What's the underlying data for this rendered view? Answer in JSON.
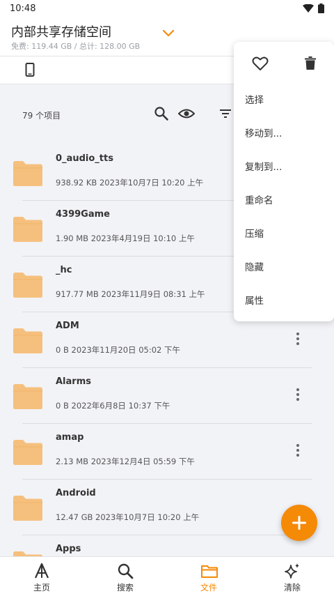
{
  "status_bar": {
    "time": "10:48"
  },
  "header": {
    "title": "内部共享存储空间",
    "subtitle": "免费: 119.44 GB / 总计: 128.00 GB"
  },
  "toolbar": {
    "item_count": "79 个项目"
  },
  "files": [
    {
      "name": "0_audio_tts",
      "meta": "938.92 KB 2023年10月7日 10:20 上午"
    },
    {
      "name": "4399Game",
      "meta": "1.90 MB 2023年4月19日 10:10 上午"
    },
    {
      "name": "_hc",
      "meta": "917.77 MB 2023年11月9日 08:31 上午"
    },
    {
      "name": "ADM",
      "meta": "0 B 2023年11月20日 05:02 下午"
    },
    {
      "name": "Alarms",
      "meta": "0 B 2022年6月8日 10:37 下午"
    },
    {
      "name": "amap",
      "meta": "2.13 MB 2023年12月4日 05:59 下午"
    },
    {
      "name": "Android",
      "meta": "12.47 GB 2023年10月7日 10:20 上午"
    },
    {
      "name": "Apps",
      "meta": ""
    }
  ],
  "context_menu": {
    "items": [
      "选择",
      "移动到...",
      "复制到...",
      "重命名",
      "压缩",
      "隐藏",
      "属性"
    ]
  },
  "bottom_nav": {
    "items": [
      {
        "label": "主页",
        "icon": "home-icon"
      },
      {
        "label": "搜索",
        "icon": "search-icon"
      },
      {
        "label": "文件",
        "icon": "folder-icon"
      },
      {
        "label": "清除",
        "icon": "sparkle-icon"
      }
    ],
    "active_index": 2
  },
  "colors": {
    "accent": "#f58a07",
    "folder": "#f5c07e",
    "background": "#f2f3f7"
  }
}
